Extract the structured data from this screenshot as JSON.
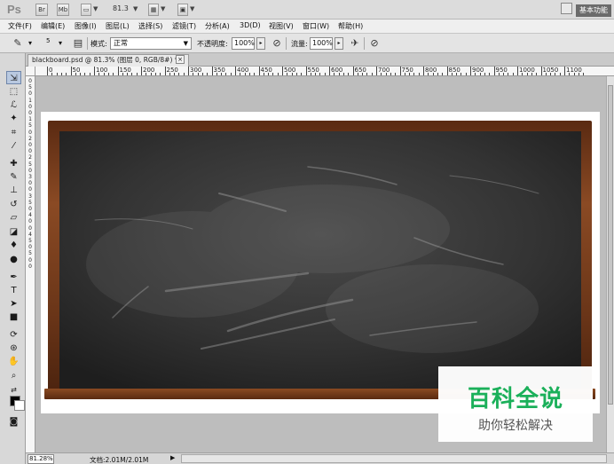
{
  "app": {
    "logo": "Ps",
    "zoom_value": "81.3",
    "workspace_label": "基本功能"
  },
  "titlebar": {
    "btn_br": "Br",
    "btn_mb": "Mb"
  },
  "menu": [
    "文件(F)",
    "编辑(E)",
    "图像(I)",
    "图层(L)",
    "选择(S)",
    "滤镜(T)",
    "分析(A)",
    "3D(D)",
    "视图(V)",
    "窗口(W)",
    "帮助(H)"
  ],
  "options": {
    "brush_size": "5",
    "mode_label": "模式:",
    "mode_value": "正常",
    "opacity_label": "不透明度:",
    "opacity_value": "100%",
    "flow_label": "流量:",
    "flow_value": "100%"
  },
  "document": {
    "tab_title": "blackboard.psd @ 81.3% (图层 0, RGB/8#) *",
    "close_glyph": "×"
  },
  "ruler_h": [
    "0",
    "50",
    "100",
    "150",
    "200",
    "250",
    "300",
    "350",
    "400",
    "450",
    "500",
    "550",
    "600",
    "650",
    "700",
    "750",
    "800",
    "850",
    "900",
    "950",
    "1000",
    "1050",
    "1100"
  ],
  "ruler_v": [
    "0",
    "5",
    "0",
    "1",
    "0",
    "0",
    "1",
    "5",
    "0",
    "2",
    "0",
    "0",
    "2",
    "5",
    "0",
    "3",
    "0",
    "0",
    "3",
    "5",
    "0",
    "4",
    "0",
    "0",
    "4",
    "5",
    "0",
    "5",
    "0",
    "0"
  ],
  "status": {
    "zoom": "81.28%",
    "doc_info": "文档:2.01M/2.01M"
  },
  "watermark": {
    "title": "百科全说",
    "subtitle": "助你轻松解决"
  },
  "tools": [
    "move-tool",
    "marquee-tool",
    "lasso-tool",
    "quick-select-tool",
    "crop-tool",
    "eyedropper-tool",
    "spot-heal-tool",
    "brush-tool",
    "clone-stamp-tool",
    "history-brush-tool",
    "eraser-tool",
    "gradient-tool",
    "blur-tool",
    "dodge-tool",
    "pen-tool",
    "type-tool",
    "path-select-tool",
    "rectangle-tool",
    "3d-rotate-tool",
    "3d-orbit-tool",
    "hand-tool",
    "zoom-tool"
  ]
}
